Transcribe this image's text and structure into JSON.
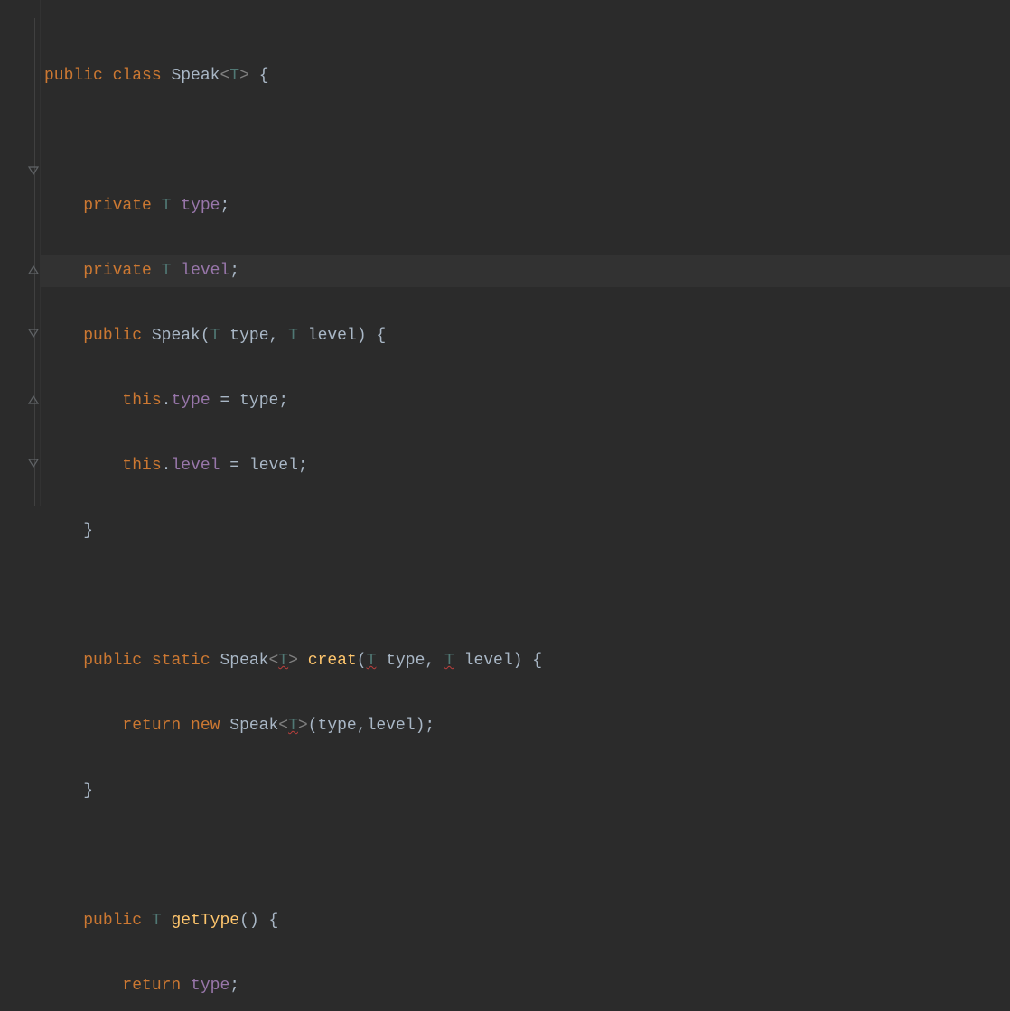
{
  "code": {
    "line1": {
      "kw_public": "public",
      "kw_class": "class",
      "classname": "Speak",
      "lt": "<",
      "T": "T",
      "gt": ">",
      "brace": "{"
    },
    "line3": {
      "kw_private": "private",
      "T": "T",
      "field": "type",
      "semi": ";"
    },
    "line4": {
      "kw_private": "private",
      "T": "T",
      "field": "level",
      "semi": ";"
    },
    "line5": {
      "kw_public": "public",
      "classname": "Speak",
      "open": "(",
      "T1": "T",
      "p1": "type",
      "comma": ",",
      "T2": "T",
      "p2": "level",
      "close": ")",
      "brace": "{"
    },
    "line6": {
      "this": "this",
      "dot": ".",
      "field": "type",
      "eq": "=",
      "param": "type",
      "semi": ";"
    },
    "line7": {
      "this": "this",
      "dot": ".",
      "field": "level",
      "eq": "=",
      "param": "level",
      "semi": ";"
    },
    "line8": {
      "close": "}"
    },
    "line10": {
      "kw_public": "public",
      "kw_static": "static",
      "classname": "Speak",
      "lt": "<",
      "T": "T",
      "gt": ">",
      "method": "creat",
      "open": "(",
      "T1": "T",
      "p1": "type",
      "comma": ",",
      "T2": "T",
      "p2": "level",
      "close": ")",
      "brace": "{"
    },
    "line11": {
      "kw_return": "return",
      "kw_new": "new",
      "classname": "Speak",
      "lt": "<",
      "T": "T",
      "gt": ">",
      "open": "(",
      "p1": "type",
      "comma": ",",
      "p2": "level",
      "close": ")",
      "semi": ";"
    },
    "line12": {
      "close": "}"
    },
    "line14": {
      "kw_public": "public",
      "T": "T",
      "method": "getType",
      "open": "(",
      "close": ")",
      "brace": "{"
    },
    "line15": {
      "kw_return": "return",
      "field": "type",
      "semi": ";"
    }
  }
}
